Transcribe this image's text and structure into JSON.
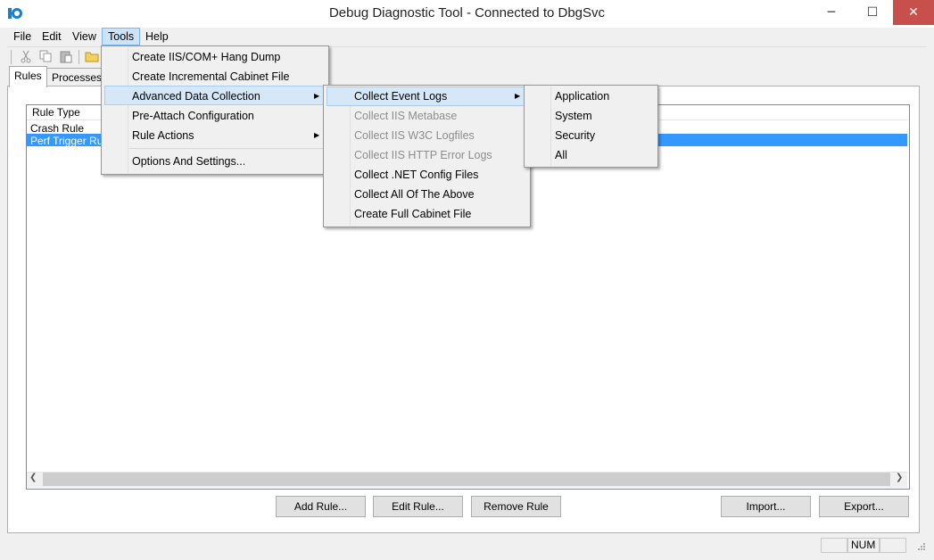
{
  "window": {
    "title": "Debug Diagnostic Tool - Connected to DbgSvc",
    "minimize": "─",
    "maximize": "☐",
    "close": "✕"
  },
  "menubar": {
    "items": [
      "File",
      "Edit",
      "View",
      "Tools",
      "Help"
    ]
  },
  "tabs": [
    "Rules",
    "Processes"
  ],
  "listview": {
    "columns": [
      "Rule Type"
    ],
    "rows": [
      "Crash Rule",
      "Perf Trigger Rule"
    ],
    "selected_index": 1
  },
  "buttons": {
    "add": "Add Rule...",
    "edit": "Edit Rule...",
    "remove": "Remove Rule",
    "import": "Import...",
    "export": "Export..."
  },
  "statusbar": {
    "num": "NUM"
  },
  "tools_menu": {
    "items": [
      "Create IIS/COM+ Hang Dump",
      "Create Incremental Cabinet File",
      "Advanced Data Collection",
      "Pre-Attach Configuration",
      "Rule Actions",
      "Options And Settings..."
    ]
  },
  "adc_menu": {
    "items": [
      "Collect Event Logs",
      "Collect IIS Metabase",
      "Collect IIS W3C Logfiles",
      "Collect IIS HTTP Error Logs",
      "Collect .NET Config Files",
      "Collect All Of The Above",
      "Create Full Cabinet File"
    ]
  },
  "event_logs_menu": {
    "items": [
      "Application",
      "System",
      "Security",
      "All"
    ]
  },
  "colors": {
    "selection": "#3399ff",
    "menu_highlight": "#d6e8f8",
    "close_button": "#c7504c"
  }
}
